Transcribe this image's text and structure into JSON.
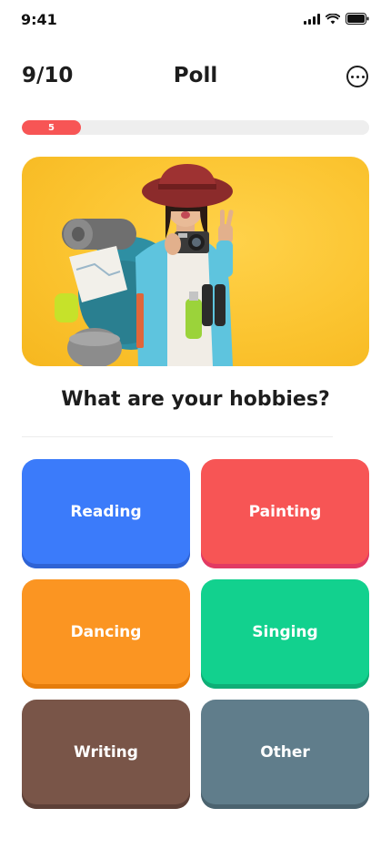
{
  "status_bar": {
    "time": "9:41"
  },
  "header": {
    "counter": "9/10",
    "title": "Poll"
  },
  "progress": {
    "label": "5",
    "fraction": 0.17
  },
  "hero": {
    "image": "traveler-with-camera-and-backpack"
  },
  "question": "What are your hobbies?",
  "options": [
    {
      "label": "Reading",
      "color": "#3b7bfa",
      "shadow": "#2f63d4"
    },
    {
      "label": "Painting",
      "color": "#f75555",
      "shadow": "#e23a63"
    },
    {
      "label": "Dancing",
      "color": "#fb9522",
      "shadow": "#e57c0b"
    },
    {
      "label": "Singing",
      "color": "#12d18e",
      "shadow": "#0fae76"
    },
    {
      "label": "Writing",
      "color": "#795548",
      "shadow": "#5d4037"
    },
    {
      "label": "Other",
      "color": "#607d8b",
      "shadow": "#4b636f"
    }
  ],
  "colors": {
    "accent": "#f75555",
    "track": "#eeeeee",
    "hero_bg": "#fbc430"
  }
}
